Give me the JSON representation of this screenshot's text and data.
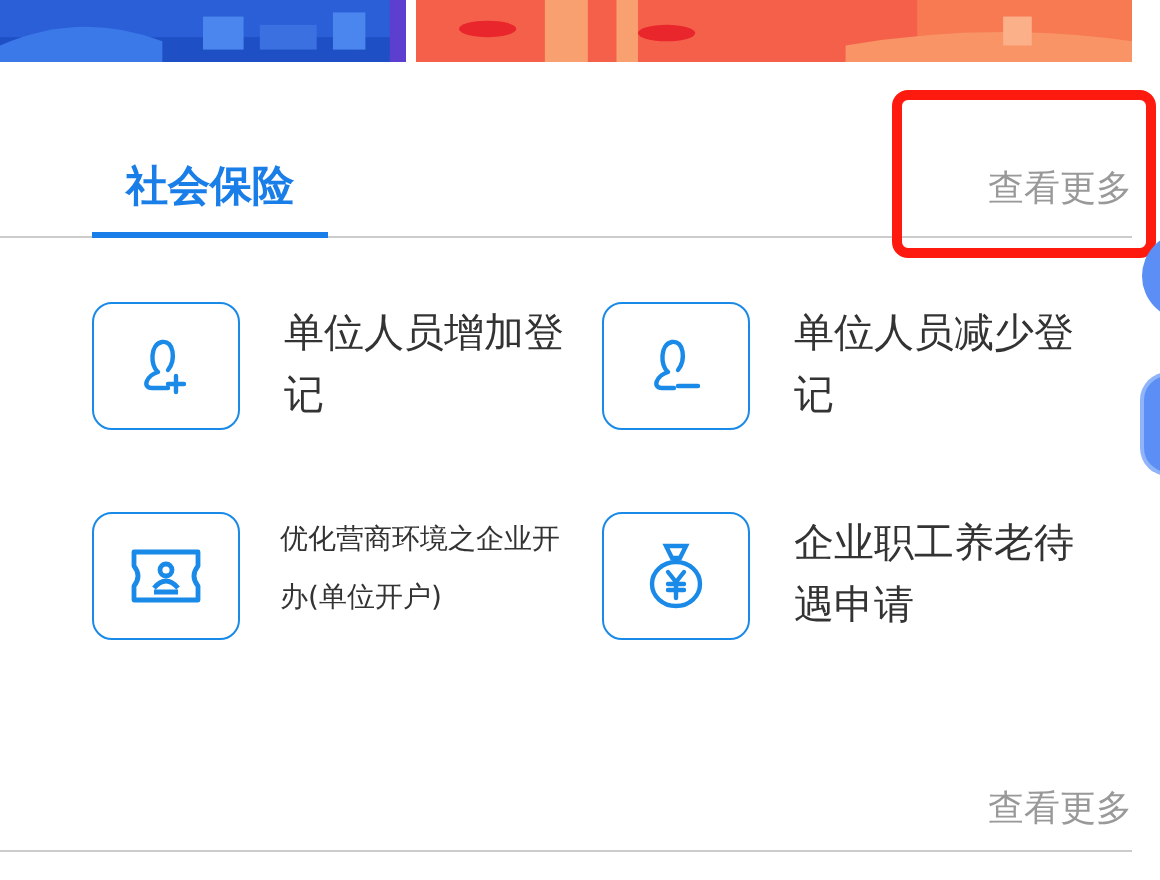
{
  "tabs": [
    {
      "label": "社会保险",
      "selected": true
    }
  ],
  "more_link_top": "查看更多",
  "services": [
    {
      "label": "单位人员增加登记",
      "kind": "person-add"
    },
    {
      "label": "单位人员减少登记",
      "kind": "person-remove"
    },
    {
      "label": "优化营商环境之企业开办(单位开户)",
      "kind": "id-card"
    },
    {
      "label": "企业职工养老待遇申请",
      "kind": "money-bag"
    }
  ],
  "more_link_bottom": "查看更多"
}
